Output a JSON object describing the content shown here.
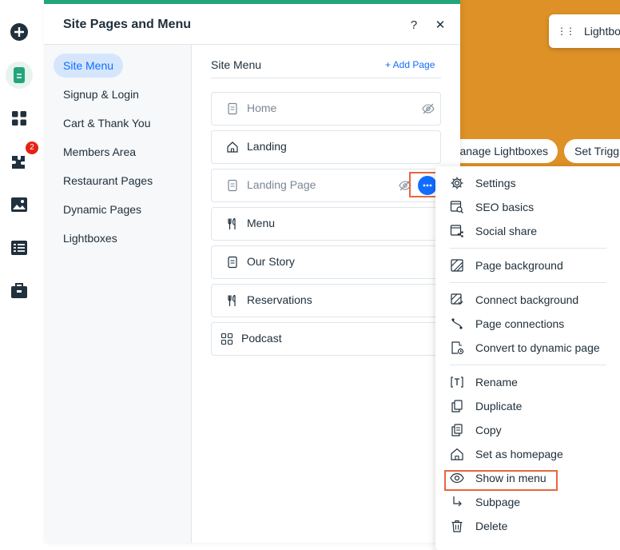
{
  "left_bar": {
    "badge_count": "2"
  },
  "canvas": {
    "lightbox_chip_label": "Lightbo",
    "manage_lightboxes_label": "Manage Lightboxes",
    "set_triggers_label": "Set Trigg"
  },
  "panel": {
    "title": "Site Pages and Menu",
    "help_label": "?",
    "close_label": "✕"
  },
  "categories": [
    {
      "label": "Site Menu",
      "active": true
    },
    {
      "label": "Signup & Login"
    },
    {
      "label": "Cart & Thank You"
    },
    {
      "label": "Members Area"
    },
    {
      "label": "Restaurant Pages"
    },
    {
      "label": "Dynamic Pages"
    },
    {
      "label": "Lightboxes"
    }
  ],
  "pages": {
    "title": "Site Menu",
    "add_page_label": "+ Add Page",
    "items": [
      {
        "label": "Home",
        "icon": "page-icon",
        "hidden": true
      },
      {
        "label": "Landing",
        "icon": "home-icon"
      },
      {
        "label": "Landing Page",
        "icon": "page-icon",
        "hidden": true,
        "selected": true
      },
      {
        "label": "Menu",
        "icon": "restaurant-icon"
      },
      {
        "label": "Our Story",
        "icon": "page-icon"
      },
      {
        "label": "Reservations",
        "icon": "restaurant-icon"
      },
      {
        "label": "Podcast",
        "icon": "apps-icon"
      }
    ]
  },
  "context_menu": {
    "items": [
      {
        "label": "Settings",
        "icon": "gear-icon"
      },
      {
        "label": "SEO basics",
        "icon": "seo-icon"
      },
      {
        "label": "Social share",
        "icon": "social-share-icon"
      },
      {
        "label": "Page background",
        "icon": "background-icon"
      },
      {
        "label": "Connect background",
        "icon": "connect-background-icon"
      },
      {
        "label": "Page connections",
        "icon": "connections-icon"
      },
      {
        "label": "Convert to dynamic page",
        "icon": "dynamic-page-icon"
      },
      {
        "label": "Rename",
        "icon": "rename-icon"
      },
      {
        "label": "Duplicate",
        "icon": "duplicate-icon"
      },
      {
        "label": "Copy",
        "icon": "copy-icon"
      },
      {
        "label": "Set as homepage",
        "icon": "home-icon"
      },
      {
        "label": "Show in menu",
        "icon": "eye-icon",
        "highlighted": true
      },
      {
        "label": "Subpage",
        "icon": "subpage-icon"
      },
      {
        "label": "Delete",
        "icon": "trash-icon"
      }
    ]
  },
  "colors": {
    "accent_blue": "#116dff",
    "brand_green": "#22a57a",
    "canvas_orange": "#de9126",
    "highlight": "#e8663f",
    "badge_red": "#e62214"
  }
}
